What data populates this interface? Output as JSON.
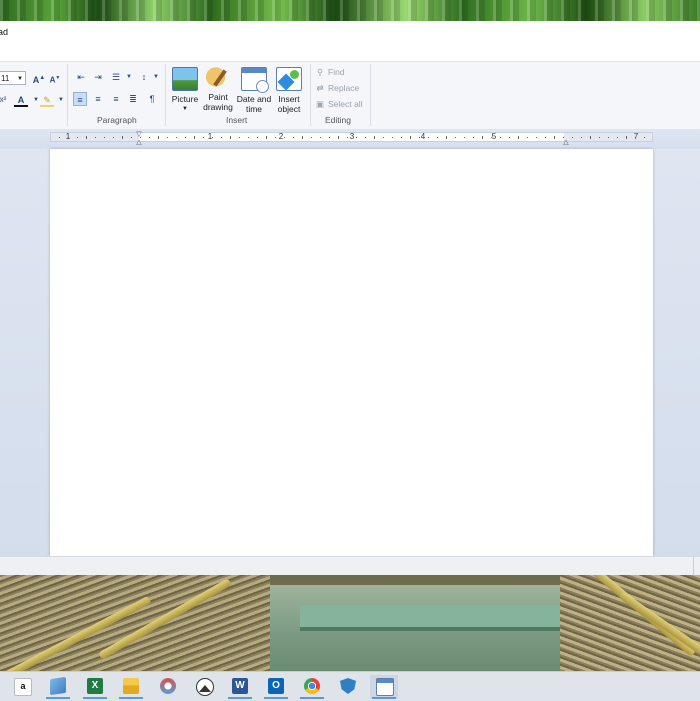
{
  "window": {
    "title_fragment": "ad"
  },
  "ribbon": {
    "font": {
      "size_value": "11"
    },
    "groups": {
      "paragraph_label": "Paragraph",
      "insert_label": "Insert",
      "editing_label": "Editing"
    },
    "insert": {
      "picture_label": "Picture",
      "paint_label_1": "Paint",
      "paint_label_2": "drawing",
      "datetime_label_1": "Date and",
      "datetime_label_2": "time",
      "object_label_1": "Insert",
      "object_label_2": "object"
    },
    "editing": {
      "find_label": "Find",
      "replace_label": "Replace",
      "select_all_label": "Select all"
    }
  },
  "ruler": {
    "numbers": [
      "1",
      "1",
      "2",
      "3",
      "4",
      "5",
      "7"
    ]
  },
  "taskbar": {
    "amazon_glyph": "a",
    "excel_glyph": "X",
    "word_glyph": "W",
    "outlook_glyph": "O",
    "items": [
      "amazon-icon",
      "notepad-icon",
      "excel-icon",
      "file-explorer-icon",
      "snipping-tool-icon",
      "photos-icon",
      "word-icon",
      "outlook-icon",
      "chrome-icon",
      "defender-icon",
      "wordpad-icon"
    ]
  },
  "colors": {
    "ribbon_bg": "#f4f6fa",
    "document_area_bg": "#d3ddec",
    "accent": "#5b9bd5",
    "taskbar_bg": "#dfe3ea"
  }
}
